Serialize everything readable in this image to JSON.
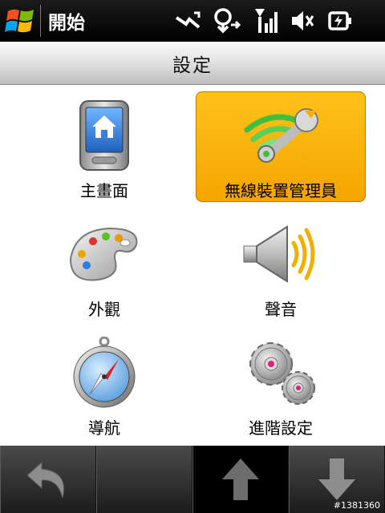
{
  "statusbar": {
    "start_label": "開始",
    "icons": [
      "connectivity-icon",
      "sync-icon",
      "signal-icon",
      "volume-mute-icon",
      "battery-charging-icon"
    ]
  },
  "page": {
    "title": "設定"
  },
  "tiles": [
    {
      "label": "主畫面",
      "icon": "home-screen-icon",
      "selected": false
    },
    {
      "label": "無線裝置管理員",
      "icon": "wireless-manager-icon",
      "selected": true
    },
    {
      "label": "外觀",
      "icon": "palette-icon",
      "selected": false
    },
    {
      "label": "聲音",
      "icon": "speaker-icon",
      "selected": false
    },
    {
      "label": "導航",
      "icon": "compass-icon",
      "selected": false
    },
    {
      "label": "進階設定",
      "icon": "gears-icon",
      "selected": false
    }
  ],
  "softkeys": [
    {
      "icon": "back-arrow-icon"
    },
    {
      "icon": "blank"
    },
    {
      "icon": "up-arrow-icon"
    },
    {
      "icon": "down-arrow-icon"
    }
  ],
  "watermark": "#1381360",
  "colors": {
    "selected": "#f7b000",
    "title_bar": "#d8d8d8",
    "status_bar": "#000000"
  }
}
